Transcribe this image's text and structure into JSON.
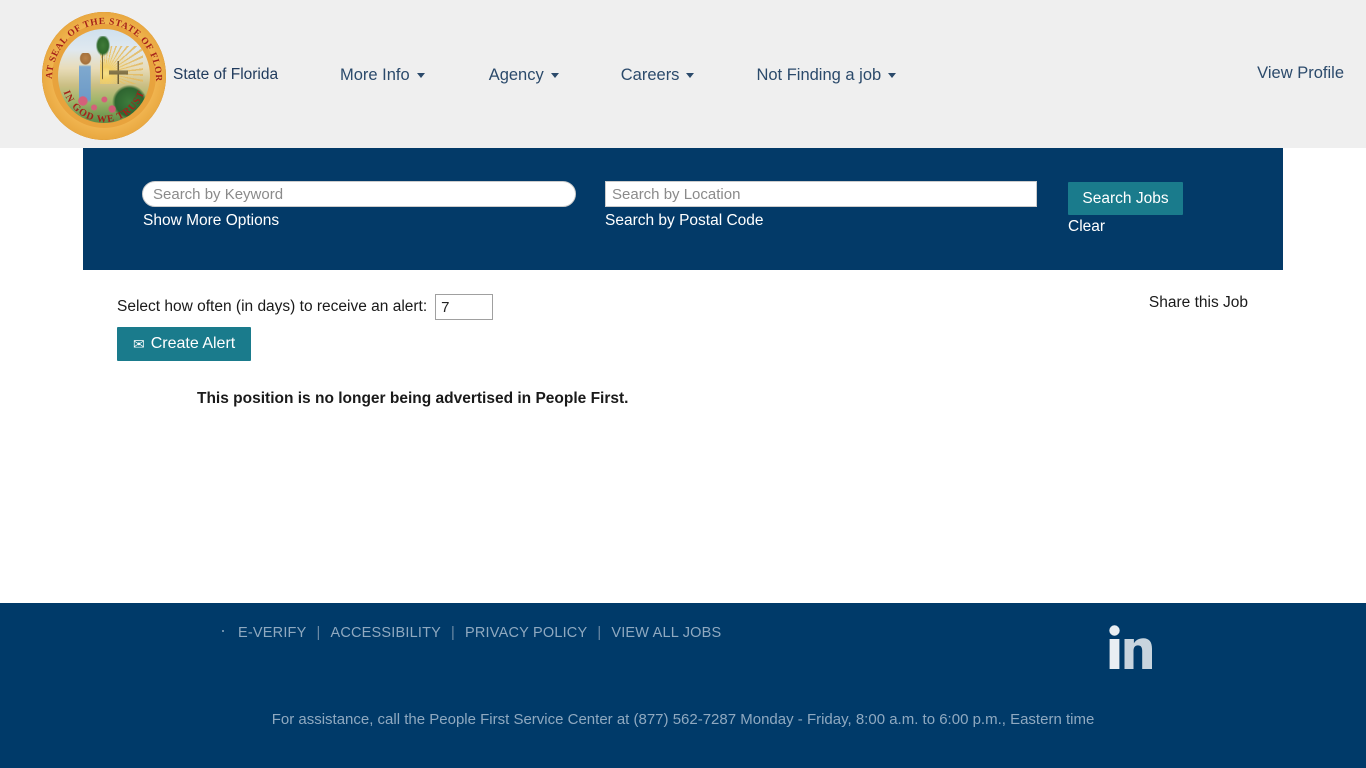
{
  "header": {
    "brand": "State of Florida",
    "seal": {
      "top_text": "GREAT SEAL OF THE STATE OF FLORIDA",
      "bottom_text": "IN GOD WE TRUST"
    },
    "nav": [
      {
        "label": "More Info",
        "has_caret": true
      },
      {
        "label": "Agency",
        "has_caret": true
      },
      {
        "label": "Careers",
        "has_caret": true
      },
      {
        "label": "Not Finding a job",
        "has_caret": true
      }
    ],
    "view_profile": "View Profile"
  },
  "search": {
    "keyword_placeholder": "Search by Keyword",
    "keyword_value": "",
    "location_placeholder": "Search by Location",
    "location_value": "",
    "show_more_options": "Show More Options",
    "postal_code": "Search by Postal Code",
    "search_button": "Search Jobs",
    "clear_link": "Clear"
  },
  "alert": {
    "label": "Select how often (in days) to receive an alert:",
    "days_value": "7",
    "create_button": "Create Alert",
    "envelope_icon": "✉",
    "share_job": "Share this Job"
  },
  "main": {
    "message": "This position is no longer being advertised in People First."
  },
  "footer": {
    "links": [
      "E-VERIFY",
      "ACCESSIBILITY",
      "PRIVACY POLICY",
      "VIEW ALL JOBS"
    ],
    "separator": "|",
    "social_icon": "linkedin-icon",
    "assistance": "For assistance, call the People First Service Center at (877) 562-7287 Monday - Friday, 8:00 a.m. to 6:00 p.m., Eastern time"
  },
  "colors": {
    "header_bg": "#efefef",
    "brand_blue": "#033a68",
    "footer_blue": "#003a69",
    "teal_button": "#1a7b8c",
    "seal_gold": "#e8a33d",
    "seal_red": "#a52019",
    "footer_text": "#8fa9c0"
  }
}
